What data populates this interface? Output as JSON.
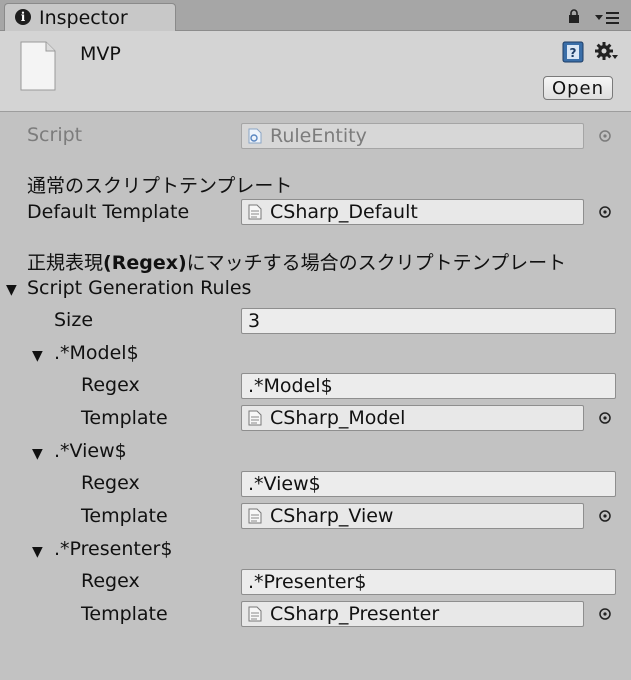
{
  "tab": {
    "title": "Inspector"
  },
  "header": {
    "object_name": "MVP",
    "open_label": "Open"
  },
  "script_row": {
    "label": "Script",
    "value": "RuleEntity"
  },
  "section1_heading": "通常のスクリプトテンプレート",
  "default_template": {
    "label": "Default Template",
    "value": "CSharp_Default"
  },
  "section2_heading_pre": "正規表現",
  "section2_heading_bold": "(Regex)",
  "section2_heading_post": "にマッチする場合のスクリプトテンプレート",
  "rules": {
    "label": "Script Generation Rules",
    "size_label": "Size",
    "size_value": "3",
    "items": [
      {
        "header": ".*Model$",
        "regex_label": "Regex",
        "regex": ".*Model$",
        "template_label": "Template",
        "template": "CSharp_Model"
      },
      {
        "header": ".*View$",
        "regex_label": "Regex",
        "regex": ".*View$",
        "template_label": "Template",
        "template": "CSharp_View"
      },
      {
        "header": ".*Presenter$",
        "regex_label": "Regex",
        "regex": ".*Presenter$",
        "template_label": "Template",
        "template": "CSharp_Presenter"
      }
    ]
  },
  "colors": {
    "panel": "#c2c2c2",
    "header": "#d4d4d4",
    "field": "#e8e8e8",
    "help_blue": "#3a6ea8"
  },
  "icons": [
    "info-icon",
    "lock-icon",
    "menu-icon",
    "file-icon",
    "help-icon",
    "gear-icon",
    "object-picker-icon",
    "foldout-arrow-icon"
  ]
}
